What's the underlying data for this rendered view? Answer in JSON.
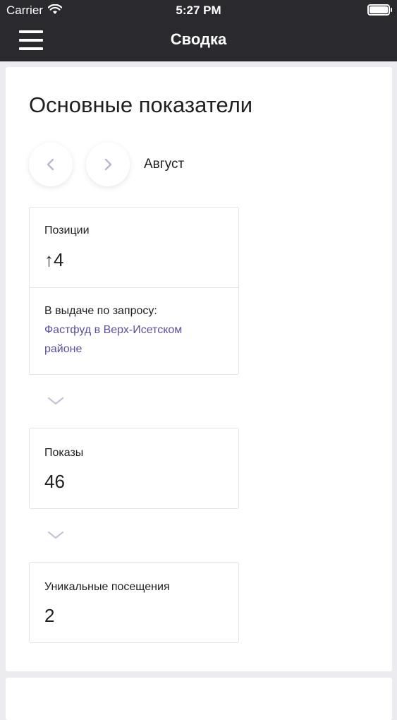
{
  "status_bar": {
    "carrier": "Carrier",
    "time": "5:27 PM"
  },
  "nav": {
    "title": "Сводка"
  },
  "summary": {
    "title": "Основные показатели",
    "month": "Август",
    "positions": {
      "label": "Позиции",
      "arrow": "↑",
      "value": "4",
      "query_label": "В выдаче по запросу:",
      "query_link": "Фастфуд в Верх-Исетском районе"
    },
    "impressions": {
      "label": "Показы",
      "value": "46"
    },
    "unique_visits": {
      "label": "Уникальные посещения",
      "value": "2"
    }
  },
  "colors": {
    "nav_background": "#2a2a2e",
    "page_background": "#ececf0",
    "link": "#5b4fa0",
    "chevron": "#b8b8cc"
  },
  "icons": [
    "wifi-icon",
    "battery-icon",
    "hamburger-menu-icon",
    "chevron-left-icon",
    "chevron-right-icon",
    "chevron-down-icon"
  ]
}
